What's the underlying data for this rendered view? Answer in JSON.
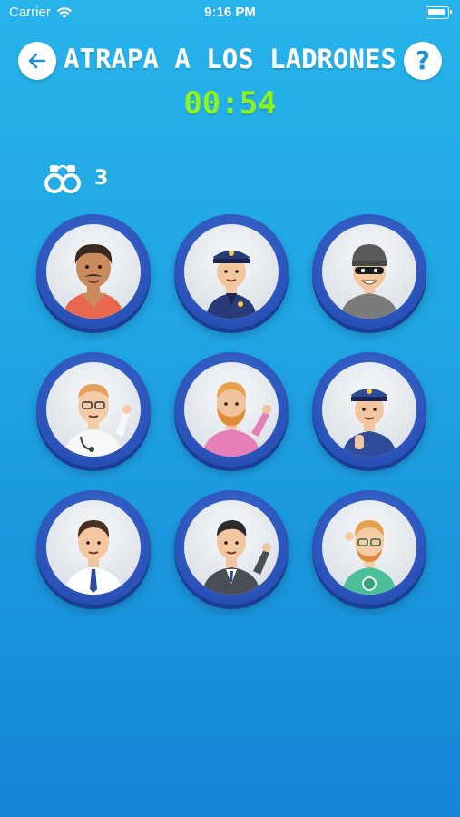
{
  "status_bar": {
    "carrier": "Carrier",
    "time": "9:16 PM"
  },
  "header": {
    "title": "ATRAPA A LOS LADRONES",
    "back_icon": "arrow-left-icon",
    "help_label": "?"
  },
  "timer": "00:54",
  "captures": {
    "icon": "handcuffs-icon",
    "count": "3"
  },
  "characters": [
    {
      "name": "mustache-man",
      "skin": "#c98a5e",
      "hair": "#3a2a22",
      "shirt": "#e8684f",
      "hat": "none"
    },
    {
      "name": "police-officer-1",
      "skin": "#f2c7a0",
      "hair": "#3a2a22",
      "shirt": "#273b78",
      "hat": "police"
    },
    {
      "name": "masked-thief",
      "skin": "#f2c7a0",
      "hair": "#5a5a5a",
      "shirt": "#7b7b7b",
      "hat": "beanie"
    },
    {
      "name": "doctor",
      "skin": "#f4cba6",
      "hair": "#e5a15a",
      "shirt": "#f8f8f8",
      "hat": "none"
    },
    {
      "name": "bearded-man",
      "skin": "#f1c39c",
      "hair": "#e8a04a",
      "shirt": "#e47fb8",
      "hat": "none"
    },
    {
      "name": "police-officer-2",
      "skin": "#f2c7a0",
      "hair": "#3a2a22",
      "shirt": "#2e4c9a",
      "hat": "police"
    },
    {
      "name": "office-man",
      "skin": "#f2c7a0",
      "hair": "#4a2e22",
      "shirt": "#ffffff",
      "hat": "none"
    },
    {
      "name": "suit-man",
      "skin": "#f2c7a0",
      "hair": "#2b2b2b",
      "shirt": "#4a4f57",
      "hat": "none"
    },
    {
      "name": "ginger-man",
      "skin": "#f4cba6",
      "hair": "#e8a04a",
      "shirt": "#4bbf9a",
      "hat": "none"
    }
  ]
}
